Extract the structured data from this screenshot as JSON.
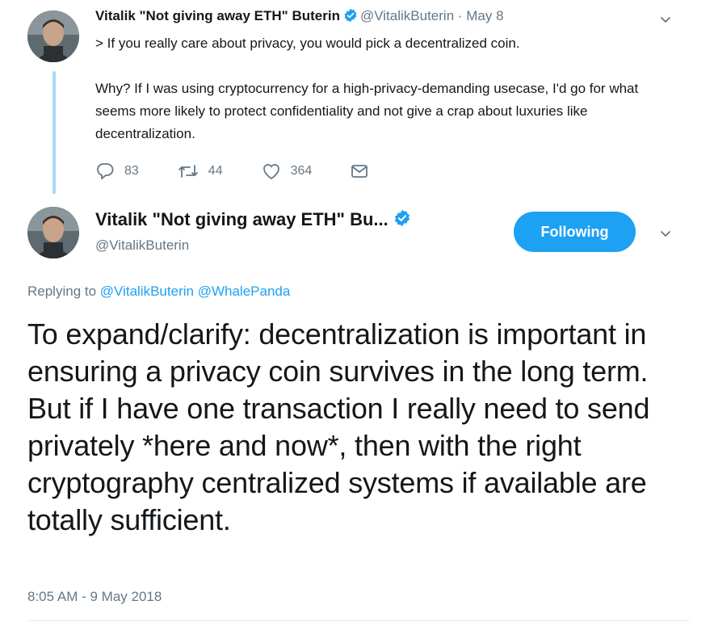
{
  "parent_tweet": {
    "display_name": "Vitalik \"Not giving away ETH\" Buterin",
    "handle": "@VitalikButerin",
    "date": "· May 8",
    "quote_line": "> If you really care about privacy, you would pick a decentralized coin.",
    "body": "Why? If I was using cryptocurrency for a high-privacy-demanding usecase, I'd go for what seems more likely to protect confidentiality and not give a crap about luxuries like decentralization.",
    "replies": "83",
    "retweets": "44",
    "likes": "364"
  },
  "main_tweet": {
    "display_name": "Vitalik \"Not giving away ETH\" Bu...",
    "handle": "@VitalikButerin",
    "follow_label": "Following",
    "replying_prefix": "Replying to",
    "replying_to_1": "@VitalikButerin",
    "replying_to_2": "@WhalePanda",
    "text": "To expand/clarify: decentralization is important in ensuring a privacy coin survives in the long term. But if I have one transaction I really need to send privately *here and now*, then with the right cryptography centralized systems if available are totally sufficient.",
    "timestamp": "8:05 AM - 9 May 2018"
  },
  "colors": {
    "accent": "#1da1f2",
    "muted": "#657786",
    "thread_line": "#a6dbf7",
    "text": "#14171a"
  },
  "icons": {
    "reply": "reply-icon",
    "retweet": "retweet-icon",
    "like": "heart-icon",
    "message": "envelope-icon",
    "verified": "verified-badge-icon",
    "caret": "chevron-down-icon"
  }
}
